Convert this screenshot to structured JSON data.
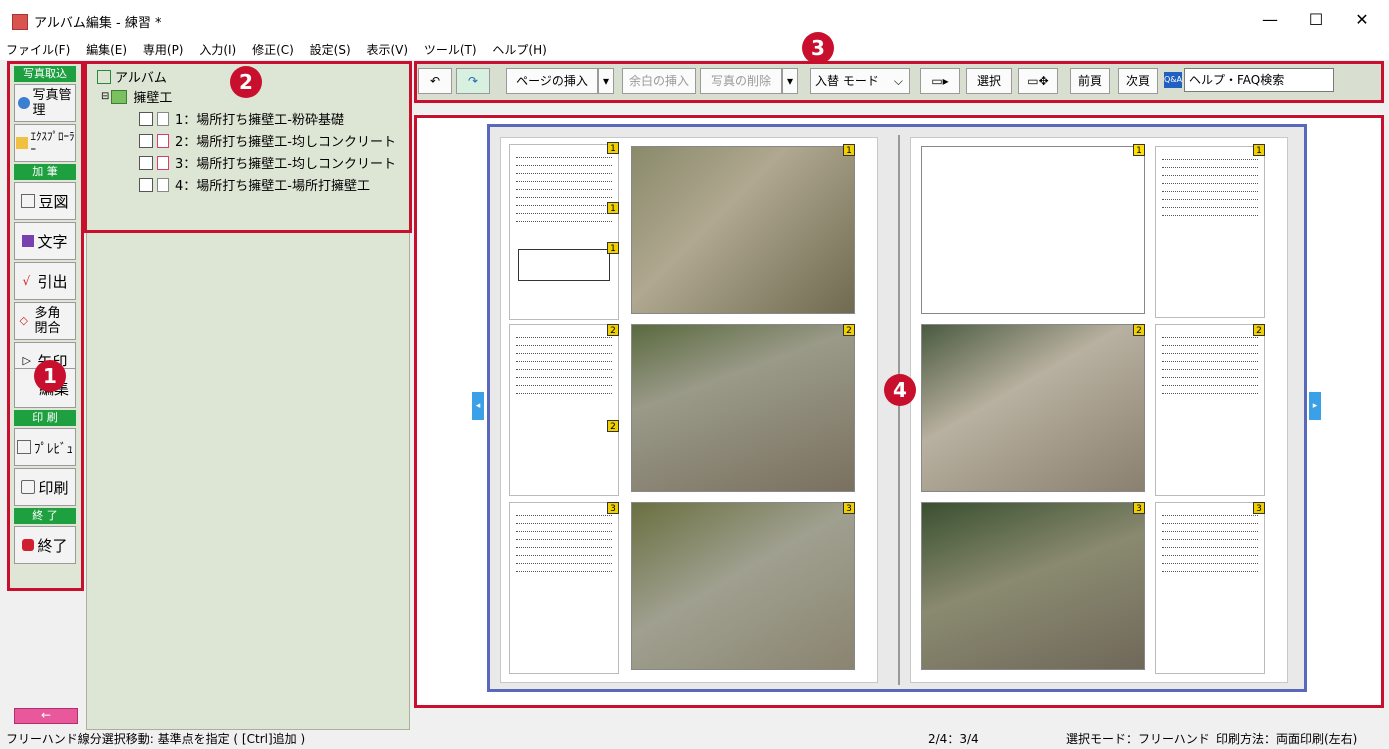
{
  "window": {
    "title": "アルバム編集 - 練習 *"
  },
  "menu": [
    "ファイル(F)",
    "編集(E)",
    "専用(P)",
    "入力(I)",
    "修正(C)",
    "設定(S)",
    "表示(V)",
    "ツール(T)",
    "ヘルプ(H)"
  ],
  "toolbox": {
    "headers": [
      "写真取込",
      "加 筆",
      "印 刷",
      "終 了"
    ],
    "photo_mgmt": "写真管理",
    "explorer": "ｴｸｽﾌﾟﾛｰﾗｰ",
    "bean_fig": "豆図",
    "text": "文字",
    "leader": "引出",
    "polygon": "多角閉合",
    "arrow": "矢印",
    "edit": "編集",
    "preview": "ﾌﾟﾚﾋﾞｭ",
    "print": "印刷",
    "exit": "終了",
    "back": "←"
  },
  "tree": {
    "root": "アルバム",
    "folder": "擁壁工",
    "items": [
      "1：場所打ち擁壁工-粉砕基礎",
      "2：場所打ち擁壁工-均しコンクリート",
      "3：場所打ち擁壁工-均しコンクリート",
      "4：場所打ち擁壁工-場所打擁壁工"
    ]
  },
  "toolbar": {
    "insert_page": "ページの挿入",
    "insert_margin": "余白の挿入",
    "delete_photo": "写真の削除",
    "mode": "入替 モード",
    "select": "選択",
    "prev": "前頁",
    "next": "次頁",
    "search_label": "ヘルプ・FAQ検索"
  },
  "badges": [
    "1",
    "2",
    "3",
    "4"
  ],
  "album": {
    "left_page_nums": [
      "1",
      "1",
      "1",
      "2",
      "2",
      "2",
      "3",
      "3"
    ],
    "right_page_nums": [
      "1",
      "1",
      "2",
      "2",
      "3",
      "3"
    ]
  },
  "status": {
    "left": "フリーハンド線分選択移動: 基準点を指定 ( [Ctrl]追加 )",
    "page": "2/4：3/4",
    "mode": "選択モード：フリーハンド",
    "print": "印刷方法：両面印刷(左右)"
  },
  "colors": {
    "accent_red": "#c8102e",
    "green_header": "#1fa040",
    "album_border": "#5968b8"
  }
}
